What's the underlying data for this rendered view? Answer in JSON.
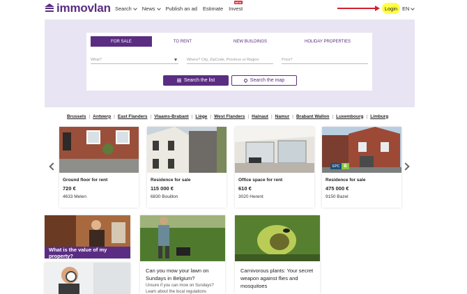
{
  "header": {
    "logo_text": "immovlan",
    "nav": [
      {
        "label": "Search"
      },
      {
        "label": "News"
      },
      {
        "label": "Publish an ad"
      },
      {
        "label": "Estimate"
      },
      {
        "label": "Invest",
        "badge": "NEW"
      }
    ],
    "login_label": "Login",
    "lang_label": "EN"
  },
  "search": {
    "tabs": [
      "FOR SALE",
      "TO RENT",
      "NEW BUILDINGS",
      "HOLIDAY PROPERTIES"
    ],
    "active_tab": "FOR SALE",
    "what_placeholder": "What?",
    "where_placeholder": "Where? City, ZipCode, Province or Region",
    "price_placeholder": "Price?",
    "list_button": "Search the list",
    "map_button": "Search the map"
  },
  "regions": [
    "Brussels",
    "Antwerp",
    "East Flanders",
    "Vlaams-Brabant",
    "Liège",
    "West Flanders",
    "Hainaut",
    "Namur",
    "Brabant Wallon",
    "Luxembourg",
    "Limburg"
  ],
  "listings": [
    {
      "type": "Ground floor for rent",
      "price": "720 €",
      "location": "4633 Melen"
    },
    {
      "type": "Residence for sale",
      "price": "115 000 €",
      "location": "6830 Bouillon"
    },
    {
      "type": "Office space for rent",
      "price": "610 €",
      "location": "3020 Herent"
    },
    {
      "type": "Residence for sale",
      "price": "475 000 €",
      "location": "9150 Bazel",
      "epc_label": "EPC",
      "epc_rating": "B"
    }
  ],
  "blog": [
    {
      "banner": "What is the value of my property?"
    },
    {
      "title": "Can you mow your lawn on Sundays in Belgium?",
      "text": "Unsure if you can mow on Sundays? Learn about the local regulations"
    },
    {
      "title": "Carnivorous plants: Your secret weapon against flies and mosquitoes"
    }
  ],
  "colors": {
    "brand": "#5a2d82",
    "hero_bg": "#e9e4f3",
    "login_highlight": "#ffff44",
    "annotation_arrow": "#d0202e"
  }
}
